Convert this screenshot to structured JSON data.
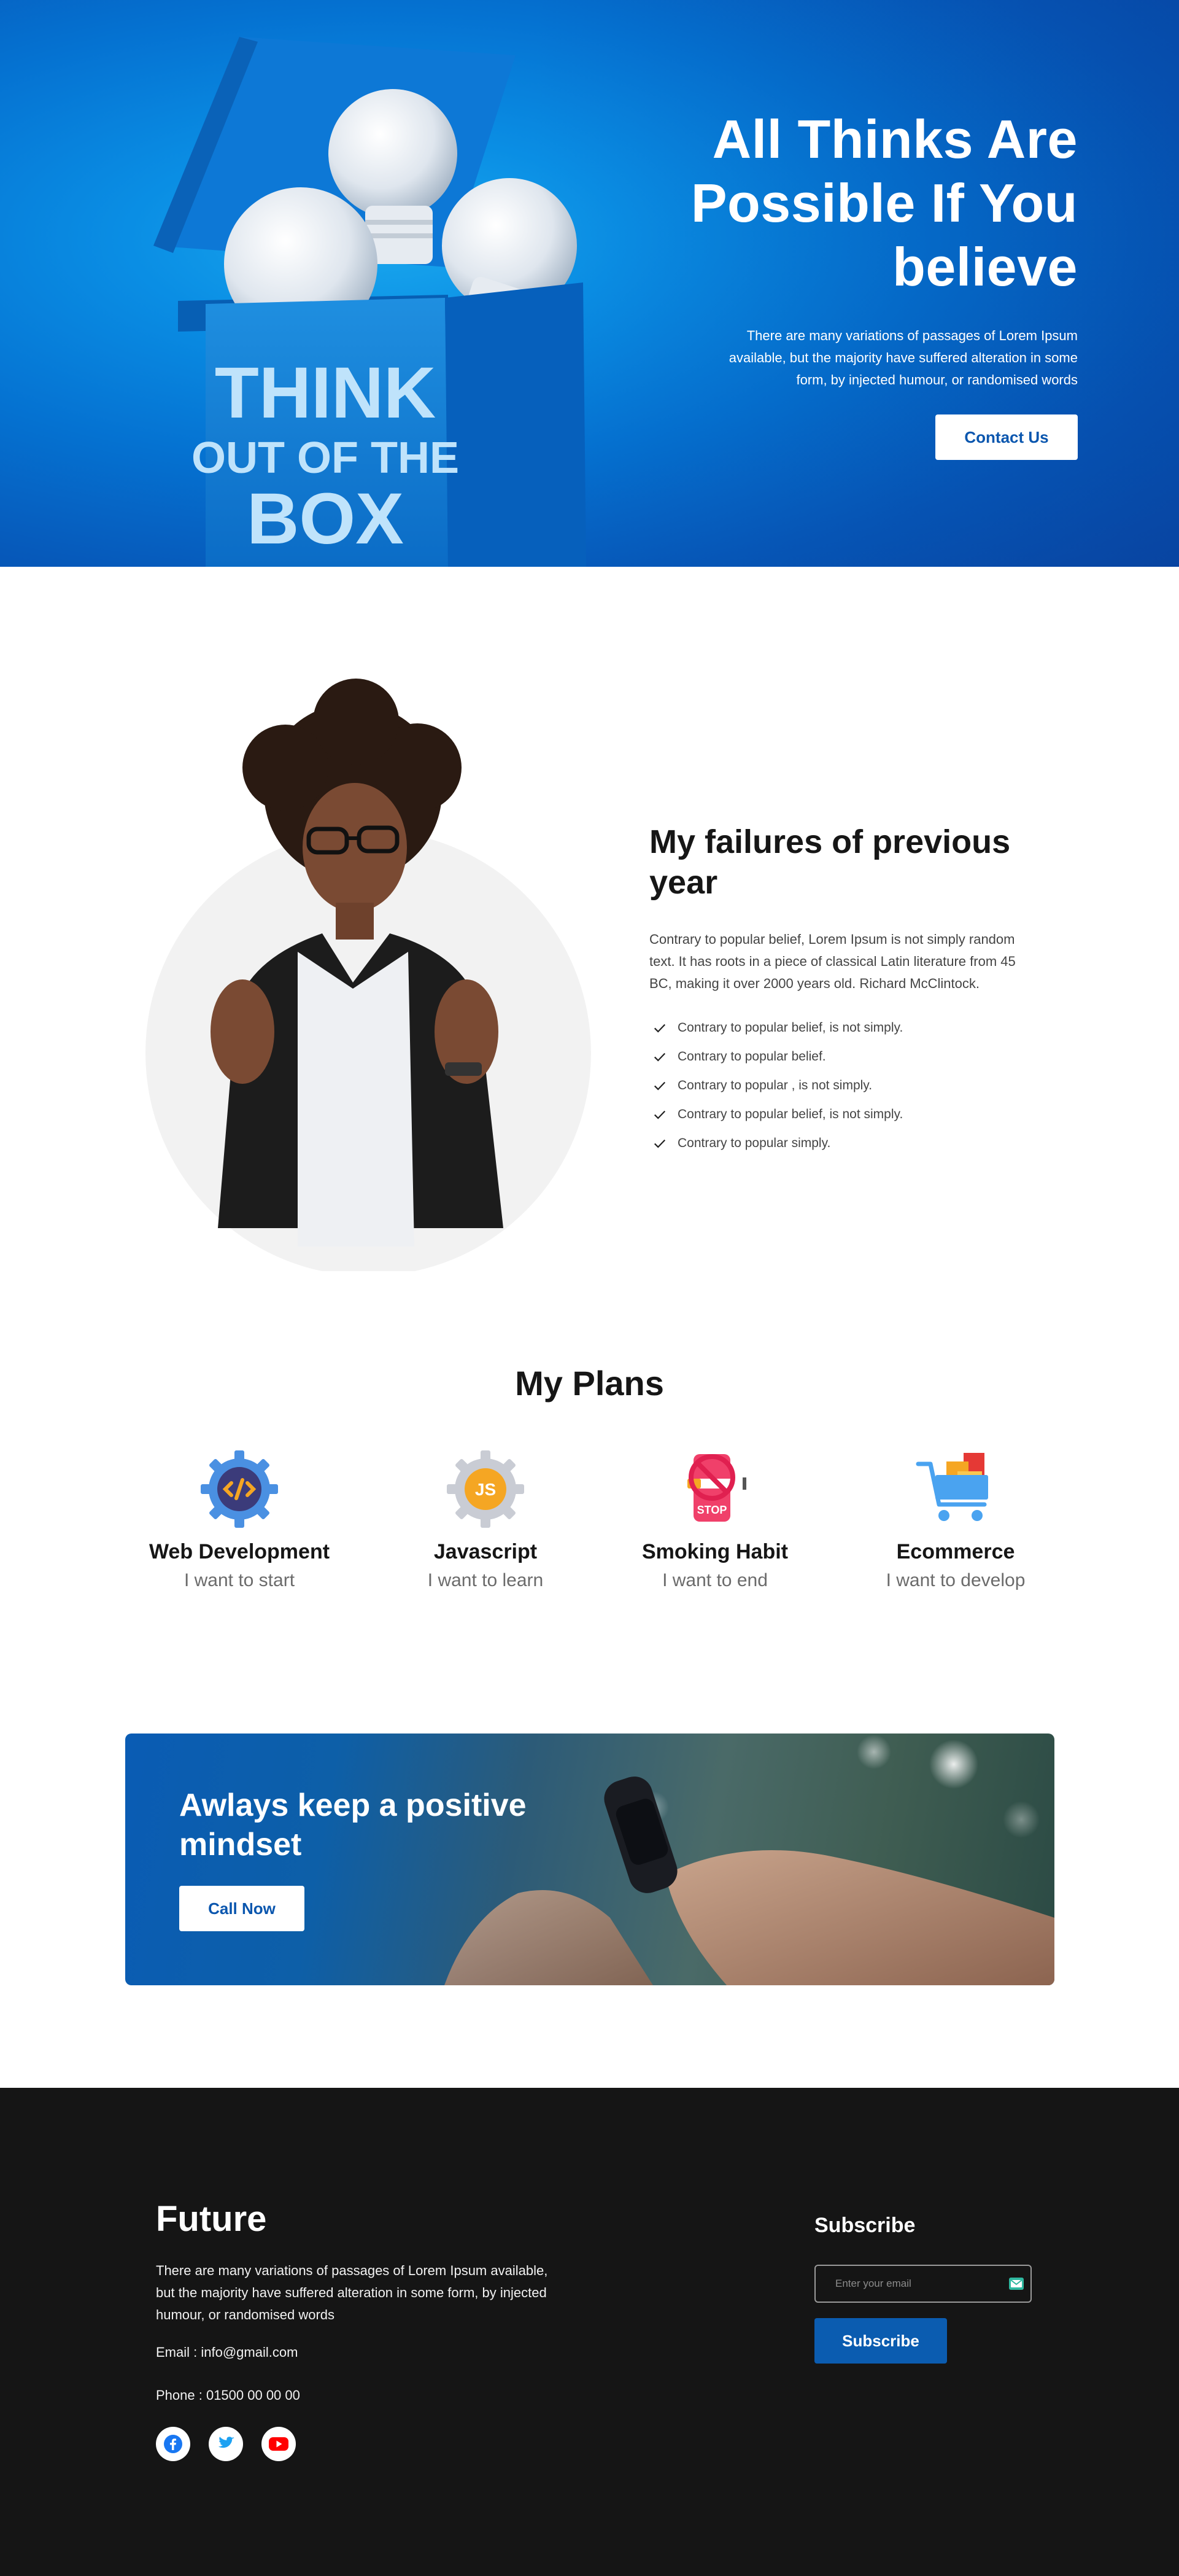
{
  "hero": {
    "title": "All Thinks Are Possible If You believe",
    "text": "There are many variations of passages of Lorem Ipsum available, but the majority have suffered alteration in some form, by injected humour, or randomised words",
    "cta": "Contact Us",
    "box_lines": [
      "THINK",
      "OUT OF THE",
      "BOX"
    ]
  },
  "failures": {
    "title": "My failures of previous year",
    "text": "Contrary to popular belief, Lorem Ipsum is not simply random text. It has roots in a piece of classical Latin literature from 45 BC, making it over 2000 years old. Richard McClintock.",
    "items": [
      "Contrary to popular belief, is not simply.",
      "Contrary to popular belief.",
      "Contrary to popular , is not simply.",
      "Contrary to popular belief, is not simply.",
      "Contrary to popular simply."
    ]
  },
  "plans": {
    "title": "My Plans",
    "items": [
      {
        "title": "Web Development",
        "subtitle": "I want to start",
        "icon": "code-gear-icon"
      },
      {
        "title": "Javascript",
        "subtitle": "I want to learn",
        "icon": "js-gear-icon"
      },
      {
        "title": "Smoking Habit",
        "subtitle": "I want to end",
        "icon": "no-smoking-icon"
      },
      {
        "title": "Ecommerce",
        "subtitle": "I want to develop",
        "icon": "shopping-cart-icon"
      }
    ],
    "js_badge": "JS",
    "stop_label": "STOP"
  },
  "banner": {
    "title": "Awlays keep a positive mindset",
    "cta": "Call Now"
  },
  "footer": {
    "brand": "Future",
    "text": "There are many variations of passages of Lorem Ipsum available, but the majority have suffered alteration in some form, by injected humour, or randomised words",
    "email": "Email : info@gmail.com",
    "phone": "Phone : 01500 00 00 00",
    "socials": [
      "facebook-icon",
      "twitter-icon",
      "youtube-icon"
    ],
    "subscribe_title": "Subscribe",
    "email_placeholder": "Enter your email",
    "subscribe_button": "Subscribe"
  },
  "colors": {
    "brand_blue": "#0b5cb0",
    "dark": "#151515",
    "text_dark": "#161616",
    "text_muted": "#6b6b6b"
  }
}
